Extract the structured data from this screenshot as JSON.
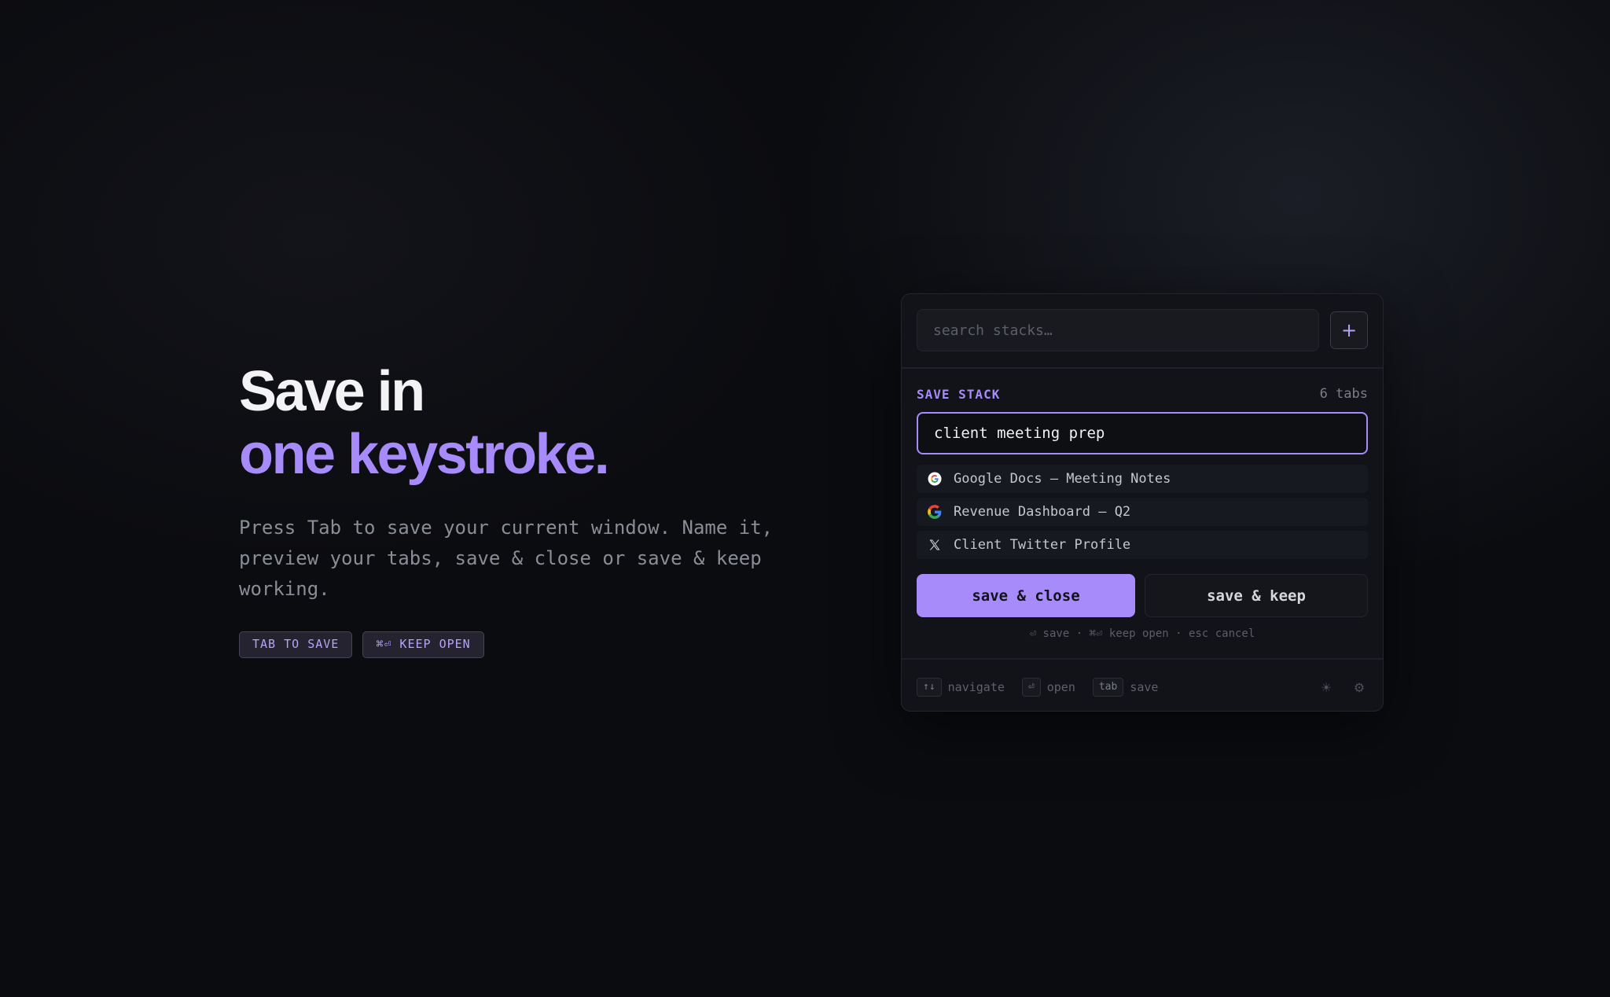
{
  "hero": {
    "title_line1": "Save in",
    "title_line2": "one keystroke.",
    "description": "Press Tab to save your current window. Name it, preview your tabs, save & close or save & keep working.",
    "badges": [
      "TAB TO SAVE",
      "⌘⏎ KEEP OPEN"
    ]
  },
  "panel": {
    "search_placeholder": "search stacks…",
    "add_label": "+",
    "save_label": "SAVE STACK",
    "tab_count": "6 tabs",
    "stack_name_value": "client meeting prep",
    "tabs": [
      {
        "title": "Google Docs — Meeting Notes",
        "icon": "google-docs-icon"
      },
      {
        "title": "Revenue Dashboard — Q2",
        "icon": "google-icon"
      },
      {
        "title": "Client Twitter Profile",
        "icon": "x-twitter-icon"
      }
    ],
    "save_close_label": "save & close",
    "save_keep_label": "save & keep",
    "hint": "⏎ save · ⌘⏎ keep open · esc cancel",
    "footer": {
      "shortcuts": [
        {
          "key": "↑↓",
          "label": "navigate"
        },
        {
          "key": "⏎",
          "label": "open"
        },
        {
          "key": "tab",
          "label": "save"
        }
      ],
      "theme_icon": "☀",
      "settings_icon": "⚙"
    }
  },
  "colors": {
    "accent": "#a78bfa",
    "background": "#0b0c10",
    "panel": "#121318"
  }
}
